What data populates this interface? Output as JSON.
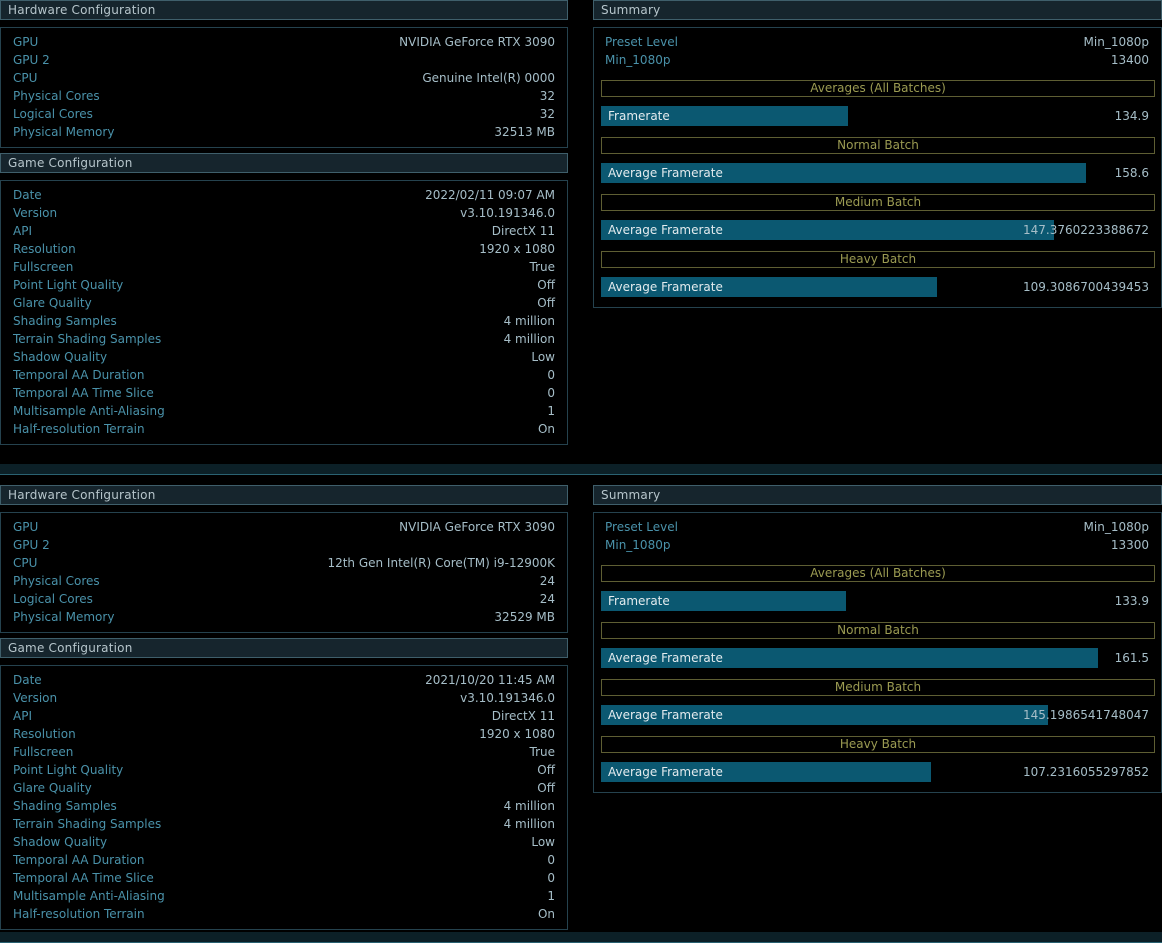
{
  "colors": {
    "background": "#000000",
    "panel_header_bg": "#16252d",
    "panel_header_border": "#3f5f6b",
    "panel_header_text": "#b6c5cb",
    "box_border": "#25424e",
    "label_text": "#4a92aa",
    "value_text": "#a6bec8",
    "gold_border": "#5e5e33",
    "gold_text": "#9b9b52",
    "bar_fill": "#0b5871",
    "bar_text": "#e3ebee",
    "divider_line": "#2a6272"
  },
  "panels": [
    {
      "hardware": {
        "title": "Hardware Configuration",
        "rows": [
          {
            "label": "GPU",
            "value": "NVIDIA GeForce RTX 3090"
          },
          {
            "label": "GPU 2",
            "value": ""
          },
          {
            "label": "CPU",
            "value": "Genuine Intel(R) 0000"
          },
          {
            "label": "Physical Cores",
            "value": "32"
          },
          {
            "label": "Logical Cores",
            "value": "32"
          },
          {
            "label": "Physical Memory",
            "value": "32513 MB"
          }
        ]
      },
      "game": {
        "title": "Game Configuration",
        "rows": [
          {
            "label": "Date",
            "value": "2022/02/11 09:07 AM"
          },
          {
            "label": "Version",
            "value": "v3.10.191346.0"
          },
          {
            "label": "API",
            "value": "DirectX 11"
          },
          {
            "label": "Resolution",
            "value": "1920 x 1080"
          },
          {
            "label": "Fullscreen",
            "value": "True"
          },
          {
            "label": "Point Light Quality",
            "value": "Off"
          },
          {
            "label": "Glare Quality",
            "value": "Off"
          },
          {
            "label": "Shading Samples",
            "value": "4 million"
          },
          {
            "label": "Terrain Shading Samples",
            "value": "4 million"
          },
          {
            "label": "Shadow Quality",
            "value": "Low"
          },
          {
            "label": "Temporal AA Duration",
            "value": "0"
          },
          {
            "label": "Temporal AA Time Slice",
            "value": "0"
          },
          {
            "label": "Multisample Anti-Aliasing",
            "value": "1"
          },
          {
            "label": "Half-resolution Terrain",
            "value": "On"
          }
        ]
      },
      "summary": {
        "title": "Summary",
        "rows": [
          {
            "label": "Preset Level",
            "value": "Min_1080p"
          },
          {
            "label": "Min_1080p",
            "value": "13400"
          }
        ],
        "sections": [
          {
            "header": "Averages (All Batches)",
            "bar_label": "Framerate",
            "value": "134.9",
            "pct": 44.5
          },
          {
            "header": "Normal Batch",
            "bar_label": "Average Framerate",
            "value": "158.6",
            "pct": 87.6
          },
          {
            "header": "Medium Batch",
            "bar_label": "Average Framerate",
            "value": "147.3760223388672",
            "pct": 81.7
          },
          {
            "header": "Heavy Batch",
            "bar_label": "Average Framerate",
            "value": "109.3086700439453",
            "pct": 60.7
          }
        ]
      }
    },
    {
      "hardware": {
        "title": "Hardware Configuration",
        "rows": [
          {
            "label": "GPU",
            "value": "NVIDIA GeForce RTX 3090"
          },
          {
            "label": "GPU 2",
            "value": ""
          },
          {
            "label": "CPU",
            "value": "12th Gen Intel(R) Core(TM) i9-12900K"
          },
          {
            "label": "Physical Cores",
            "value": "24"
          },
          {
            "label": "Logical Cores",
            "value": "24"
          },
          {
            "label": "Physical Memory",
            "value": "32529 MB"
          }
        ]
      },
      "game": {
        "title": "Game Configuration",
        "rows": [
          {
            "label": "Date",
            "value": "2021/10/20 11:45 AM"
          },
          {
            "label": "Version",
            "value": "v3.10.191346.0"
          },
          {
            "label": "API",
            "value": "DirectX 11"
          },
          {
            "label": "Resolution",
            "value": "1920 x 1080"
          },
          {
            "label": "Fullscreen",
            "value": "True"
          },
          {
            "label": "Point Light Quality",
            "value": "Off"
          },
          {
            "label": "Glare Quality",
            "value": "Off"
          },
          {
            "label": "Shading Samples",
            "value": "4 million"
          },
          {
            "label": "Terrain Shading Samples",
            "value": "4 million"
          },
          {
            "label": "Shadow Quality",
            "value": "Low"
          },
          {
            "label": "Temporal AA Duration",
            "value": "0"
          },
          {
            "label": "Temporal AA Time Slice",
            "value": "0"
          },
          {
            "label": "Multisample Anti-Aliasing",
            "value": "1"
          },
          {
            "label": "Half-resolution Terrain",
            "value": "On"
          }
        ]
      },
      "summary": {
        "title": "Summary",
        "rows": [
          {
            "label": "Preset Level",
            "value": "Min_1080p"
          },
          {
            "label": "Min_1080p",
            "value": "13300"
          }
        ],
        "sections": [
          {
            "header": "Averages (All Batches)",
            "bar_label": "Framerate",
            "value": "133.9",
            "pct": 44.3
          },
          {
            "header": "Normal Batch",
            "bar_label": "Average Framerate",
            "value": "161.5",
            "pct": 89.8
          },
          {
            "header": "Medium Batch",
            "bar_label": "Average Framerate",
            "value": "145.1986541748047",
            "pct": 80.6
          },
          {
            "header": "Heavy Batch",
            "bar_label": "Average Framerate",
            "value": "107.2316055297852",
            "pct": 59.6
          }
        ]
      }
    }
  ]
}
